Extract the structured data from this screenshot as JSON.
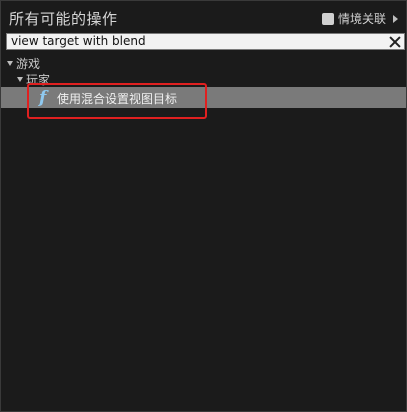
{
  "header": {
    "title": "所有可能的操作",
    "context_label": "情境关联"
  },
  "search": {
    "value": "view target with blend"
  },
  "tree": {
    "category1": "游戏",
    "category2": "玩家",
    "item": "使用混合设置视图目标",
    "item_icon": "function-icon"
  },
  "colors": {
    "background": "#1b1b1b",
    "selected_row": "#7a7a7a",
    "highlight_border": "#e02020",
    "function_icon": "#8fc9f0"
  }
}
